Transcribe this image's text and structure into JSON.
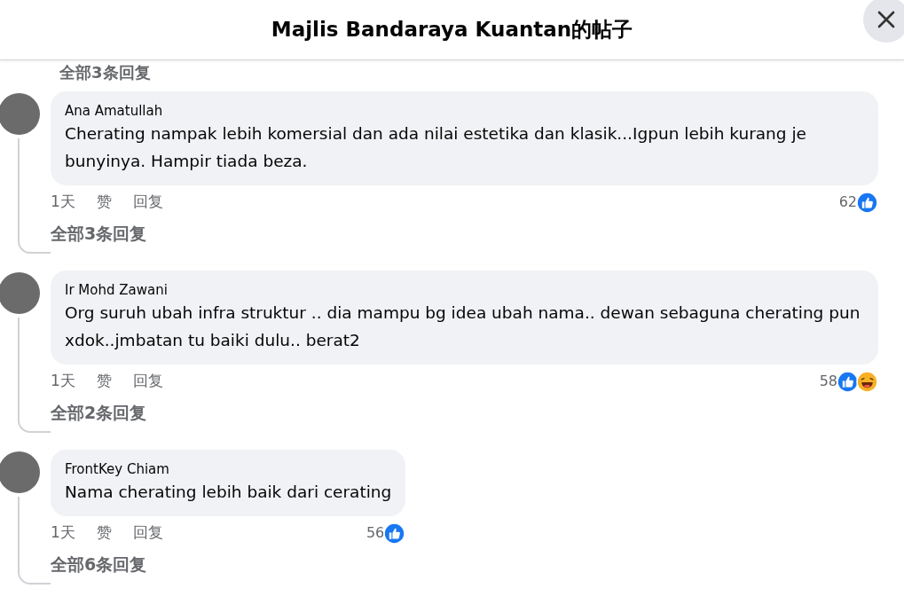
{
  "header": {
    "title": "Majlis Bandaraya Kuantan的帖子"
  },
  "top_reply_link": "全部3条回复",
  "comments": [
    {
      "author": "Ana Amatullah",
      "text": "Cherating nampak lebih komersial dan ada nilai estetika dan klasik...Igpun lebih kurang je bunyinya. Hampir tiada beza.",
      "time": "1天",
      "like": "赞",
      "reply": "回复",
      "reaction_count": "62",
      "reactions": [
        {
          "kind": "like"
        }
      ],
      "replies_link": "全部3条回复"
    },
    {
      "author": "Ir Mohd Zawani",
      "text": "Org suruh ubah infra struktur .. dia mampu bg idea ubah nama.. dewan sebaguna cherating pun xdok..jmbatan tu baiki dulu.. berat2",
      "time": "1天",
      "like": "赞",
      "reply": "回复",
      "reaction_count": "58",
      "reactions": [
        {
          "kind": "like"
        },
        {
          "kind": "haha"
        }
      ],
      "replies_link": "全部2条回复"
    },
    {
      "author": "FrontKey Chiam",
      "text": "Nama cherating lebih baik dari cerating",
      "time": "1天",
      "like": "赞",
      "reply": "回复",
      "reaction_count": "56",
      "reactions": [
        {
          "kind": "like"
        }
      ],
      "replies_link": "全部6条回复"
    }
  ]
}
